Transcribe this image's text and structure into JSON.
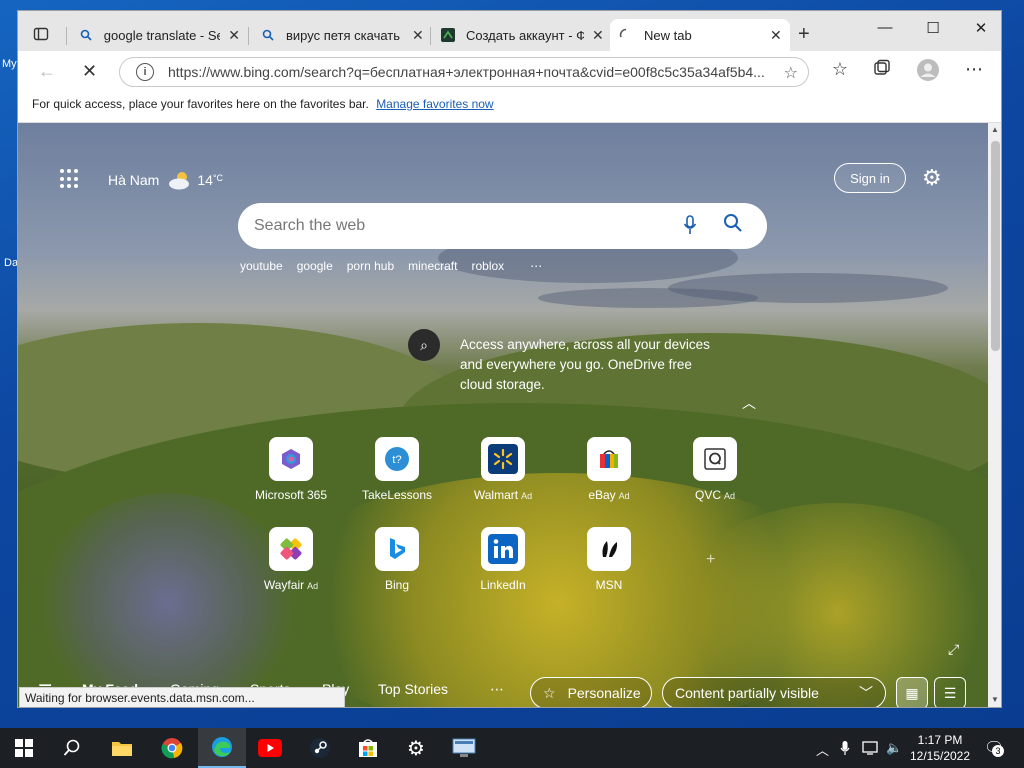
{
  "tabs": [
    {
      "title": "google translate - Sea",
      "icon": "search-icon"
    },
    {
      "title": "вирус петя скачать -",
      "icon": "search-icon"
    },
    {
      "title": "Создать аккаунт - Фо",
      "icon": "site-icon"
    },
    {
      "title": "New tab",
      "icon": "loading-icon"
    }
  ],
  "address": {
    "url": "https://www.bing.com/search?q=бесплатная+электронная+почта&cvid=e00f8c5c35a34af5b4..."
  },
  "favbar": {
    "text": "For quick access, place your favorites here on the favorites bar.",
    "link": "Manage favorites now"
  },
  "weather": {
    "location": "Hà Nam",
    "temp": "14",
    "unit": "°C"
  },
  "header": {
    "signin": "Sign in"
  },
  "search": {
    "placeholder": "Search the web"
  },
  "trending": [
    "youtube",
    "google",
    "porn hub",
    "minecraft",
    "roblox"
  ],
  "onedrive": {
    "text": "Access anywhere, across all your devices and everywhere you go. OneDrive free cloud storage."
  },
  "tiles": [
    {
      "label": "Microsoft 365",
      "ad": "",
      "icon": "microsoft365-icon"
    },
    {
      "label": "TakeLessons",
      "ad": "",
      "icon": "takelessons-icon"
    },
    {
      "label": "Walmart",
      "ad": "Ad",
      "icon": "walmart-icon"
    },
    {
      "label": "eBay",
      "ad": "Ad",
      "icon": "ebay-icon"
    },
    {
      "label": "QVC",
      "ad": "Ad",
      "icon": "qvc-icon"
    },
    {
      "label": "Wayfair",
      "ad": "Ad",
      "icon": "wayfair-icon"
    },
    {
      "label": "Bing",
      "ad": "",
      "icon": "bing-icon"
    },
    {
      "label": "LinkedIn",
      "ad": "",
      "icon": "linkedin-icon"
    },
    {
      "label": "MSN",
      "ad": "",
      "icon": "msn-icon"
    }
  ],
  "feed": {
    "tabs": [
      "My Feed",
      "Gaming",
      "Sports",
      "Play",
      "Top Stories"
    ],
    "personalize": "Personalize",
    "content": "Content partially visible"
  },
  "status": {
    "text": "Waiting for browser.events.data.msn.com..."
  },
  "desktop": {
    "frag1": "My",
    "frag2": "Da"
  },
  "clock": {
    "time": "1:17 PM",
    "date": "12/15/2022"
  },
  "notifications": {
    "count": "3"
  }
}
